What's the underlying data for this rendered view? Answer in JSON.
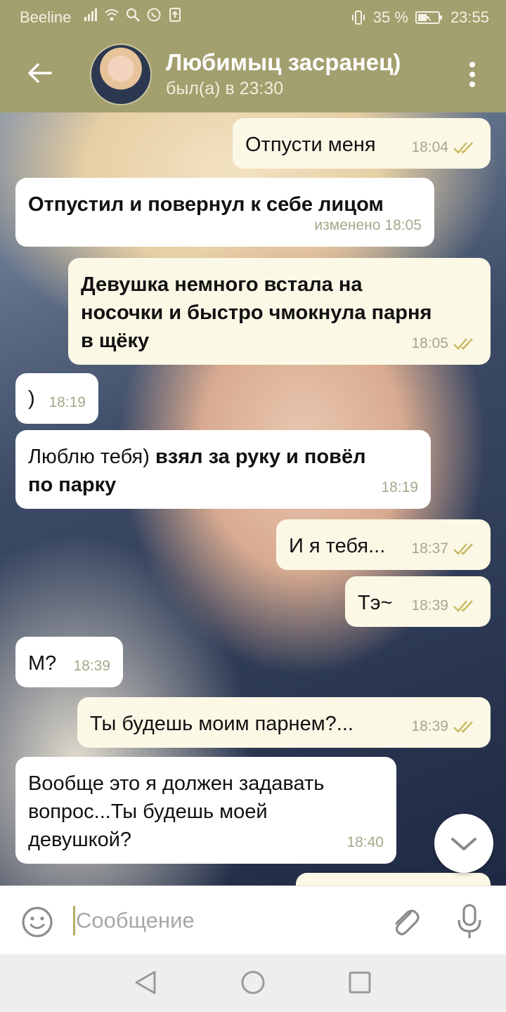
{
  "status_bar": {
    "carrier": "Beeline",
    "battery": "35 %",
    "time": "23:55"
  },
  "header": {
    "title": "Любимыц засранец)",
    "status": "был(а) в 23:30"
  },
  "messages": [
    {
      "side": "out",
      "text": "Отпусти меня",
      "time": "18:04",
      "read": true
    },
    {
      "side": "in",
      "text": "Отпустил и повернул к себе лицом",
      "edited": "изменено",
      "time": "18:05"
    },
    {
      "side": "out",
      "lines": [
        "Девушка немного встала на",
        "носочки и быстро чмокнула парня",
        "в щёку"
      ],
      "time": "18:05",
      "read": true
    },
    {
      "side": "in",
      "text": ")",
      "time": "18:19"
    },
    {
      "side": "in",
      "text_plain": "Люблю тебя)",
      "text_bold_1": "взял за руку и повёл",
      "text_bold_2": "по парку",
      "time": "18:19"
    },
    {
      "side": "out",
      "text": "И я тебя...",
      "time": "18:37",
      "read": true
    },
    {
      "side": "out",
      "text": "Тэ~",
      "time": "18:39",
      "read": true
    },
    {
      "side": "in",
      "text": "М?",
      "time": "18:39"
    },
    {
      "side": "out",
      "text": "Ты будешь моим парнем?...",
      "time": "18:39",
      "read": true
    },
    {
      "side": "in",
      "lines": [
        "Вообще это я должен задавать",
        "вопрос...Ты будешь моей",
        "девушкой?"
      ],
      "time": "18:40"
    }
  ],
  "composer": {
    "placeholder": "Сообщение"
  },
  "colors": {
    "header": "#a39f6e",
    "outgoing_bubble": "#fbf8e6",
    "incoming_bubble": "#ffffff",
    "read_checks": "#c7b861"
  },
  "icons": [
    "signal-icon",
    "wifi-icon",
    "search-icon",
    "whatsapp-icon",
    "upload-icon",
    "vibrate-icon",
    "battery-icon",
    "back-arrow-icon",
    "more-icon",
    "double-check-icon",
    "chevron-down-icon",
    "smile-icon",
    "paperclip-icon",
    "microphone-icon",
    "nav-back-icon",
    "nav-home-icon",
    "nav-recent-icon"
  ]
}
